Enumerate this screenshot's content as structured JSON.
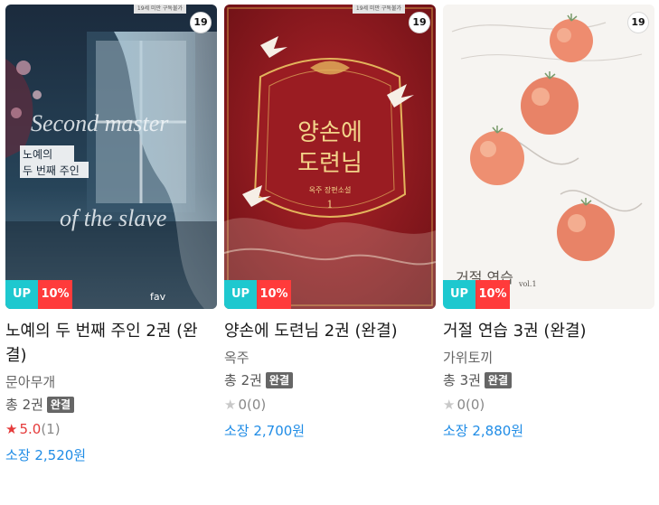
{
  "books": [
    {
      "title": "노예의 두 번째 주인 2권 (완결)",
      "author": "문아무개",
      "volumes": "총 2권",
      "status": "완결",
      "rating": "5.0",
      "rating_count": "(1)",
      "price": "소장 2,520원",
      "age_badge": "19",
      "promo_up": "UP",
      "promo_discount": "10%",
      "corner_label": "19세 미만 구독불가",
      "cover_text": {
        "script": "Second master of the slave",
        "kor_line1": "노예의",
        "kor_line2": "두 번째 주인",
        "publisher": "fav"
      }
    },
    {
      "title": "양손에 도련님 2권 (완결)",
      "author": "옥주",
      "volumes": "총 2권",
      "status": "완결",
      "rating": "0",
      "rating_count": "(0)",
      "price": "소장 2,700원",
      "age_badge": "19",
      "promo_up": "UP",
      "promo_discount": "10%",
      "corner_label": "19세 미만 구독불가",
      "cover_text": {
        "line1": "양손에",
        "line2": "도련님",
        "sub": "옥주 장편소설",
        "vol": "1"
      }
    },
    {
      "title": "거절 연습 3권 (완결)",
      "author": "가위토끼",
      "volumes": "총 3권",
      "status": "완결",
      "rating": "0",
      "rating_count": "(0)",
      "price": "소장 2,880원",
      "age_badge": "19",
      "promo_up": "UP",
      "promo_discount": "10%",
      "corner_label": "",
      "cover_text": {
        "kor": "거절 연습",
        "vol": "vol.1"
      }
    }
  ],
  "colors": {
    "up_badge": "#1ec8cf",
    "discount_badge": "#ff3b3b",
    "price_text": "#1f8ce6",
    "star_active": "#e53a3a",
    "star_inactive": "#c8c8c8",
    "status_badge": "#666666"
  },
  "icons": {
    "star": "star-icon"
  }
}
